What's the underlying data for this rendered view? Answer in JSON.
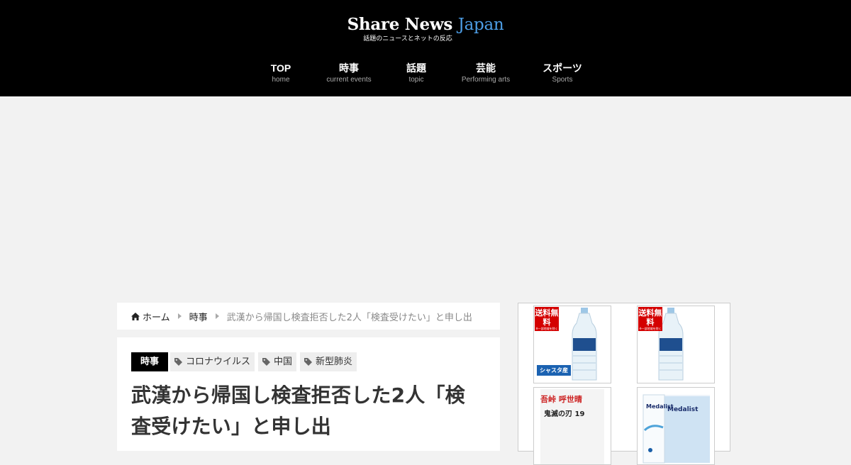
{
  "site": {
    "title": "Share News",
    "title_accent": "Japan",
    "subtitle": "話題のニュースとネットの反応"
  },
  "nav": [
    {
      "label": "TOP",
      "sub": "home"
    },
    {
      "label": "時事",
      "sub": "current events"
    },
    {
      "label": "話題",
      "sub": "topic"
    },
    {
      "label": "芸能",
      "sub": "Performing arts"
    },
    {
      "label": "スポーツ",
      "sub": "Sports"
    }
  ],
  "breadcrumb": {
    "home": "ホーム",
    "category": "時事",
    "current": "武漢から帰国し検査拒否した2人「検査受けたい」と申し出"
  },
  "article": {
    "category": "時事",
    "tags": [
      "コロナウイルス",
      "中国",
      "新型肺炎"
    ],
    "title_line1": "武漢から帰国し検査拒否した2人「検",
    "title_line2": "査受けたい」と申し出"
  },
  "sidebar": {
    "products": [
      {
        "badge": "送料無料",
        "badge_small": "※一部地域を除く",
        "label": "シャスタ産"
      },
      {
        "badge": "送料無料",
        "badge_small": "※一部地域を除く"
      },
      {
        "title": "吾峠 呼世晴",
        "subtitle": "鬼滅の刃 19"
      },
      {
        "brand": "Medalist",
        "brand2": "Medalist"
      }
    ]
  },
  "colors": {
    "header_bg": "#000000",
    "accent": "#4d9ee6",
    "category_bg": "#000000",
    "tag_bg": "#eeeeee",
    "badge_red": "#d40000"
  }
}
